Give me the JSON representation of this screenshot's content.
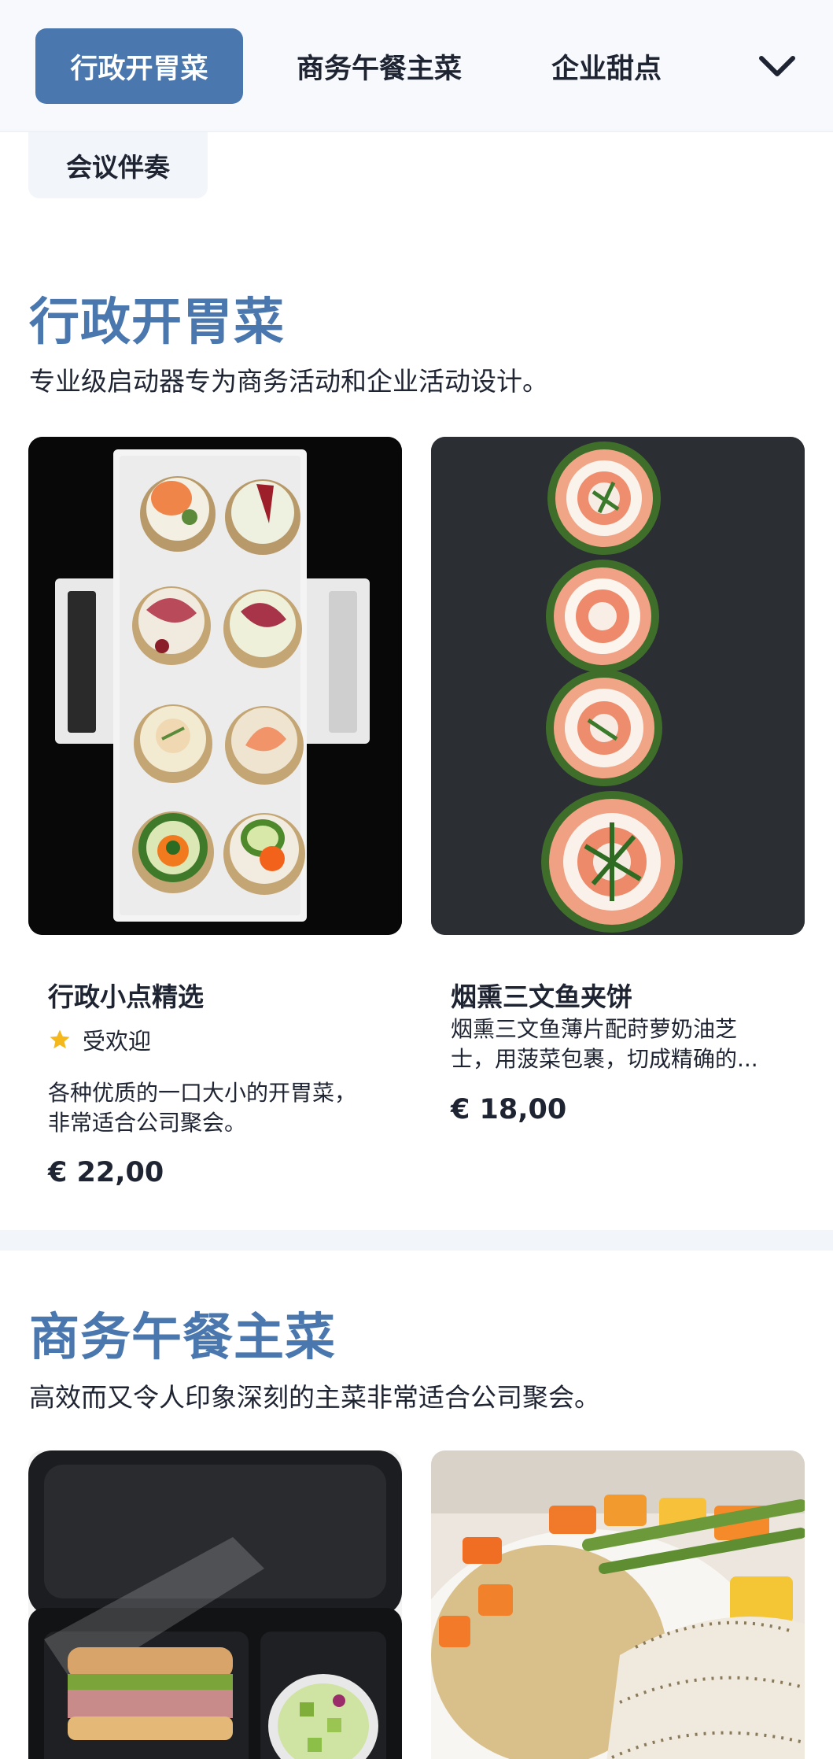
{
  "nav": {
    "tabs": [
      {
        "label": "行政开胃菜",
        "active": true
      },
      {
        "label": "商务午餐主菜",
        "active": false
      },
      {
        "label": "企业甜点",
        "active": false
      },
      {
        "label": "会议伴奏",
        "active": false
      }
    ],
    "overflow_icon": "chevron-down-icon"
  },
  "sections": [
    {
      "title": "行政开胃菜",
      "description": "专业级启动器专为商务活动和企业活动设计。",
      "products": [
        {
          "name": "行政小点精选",
          "badge": "受欢迎",
          "badge_icon": "star-icon",
          "description_lines": [
            "各种优质的一口大小的开胃菜，",
            "非常适合公司聚会。"
          ],
          "price": "€ 22,00"
        },
        {
          "name": "烟熏三文鱼夹饼",
          "description_lines": [
            "烟熏三文鱼薄片配莳萝奶油芝",
            "士，用菠菜包裹，切成精确的..."
          ],
          "price": "€ 18,00"
        }
      ]
    },
    {
      "title": "商务午餐主菜",
      "description": "高效而又令人印象深刻的主菜非常适合公司聚会。"
    }
  ],
  "colors": {
    "accent": "#4a77ad",
    "star": "#f5b81c",
    "text": "#1f2433"
  }
}
